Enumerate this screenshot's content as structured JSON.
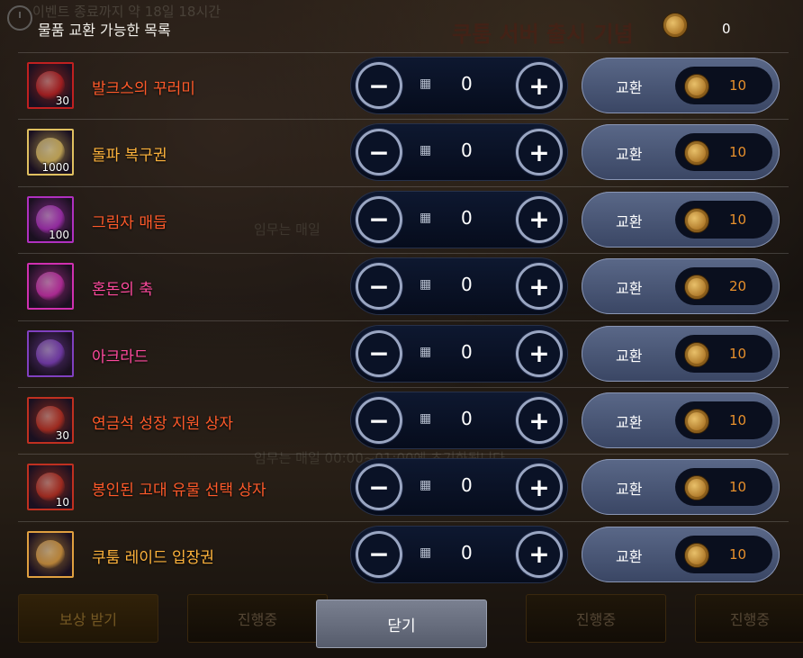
{
  "header": {
    "title": "물품 교환 가능한 목록",
    "currency_amount": "0"
  },
  "background": {
    "event_text": "이벤트 종료까지 약 18일 18시간",
    "promo_text": "쿠툼 서버 출시 기념",
    "warnings": [
      "임무는 매일",
      "임무는 매일 00:00~01:00에 초기화됩니다"
    ],
    "bottom_buttons": [
      "보상 받기",
      "진행중",
      "진행중",
      "진행중"
    ]
  },
  "colors": {
    "orange_name": "#ff6a28",
    "yellow_name": "#ffb43c",
    "pink_name": "#ff4a9e",
    "price": "#e8902c"
  },
  "items": [
    {
      "name": "발크스의 꾸러미",
      "qty": "30",
      "count": "0",
      "price": "10",
      "color": "#ff5a2a",
      "icon": "bag-icon",
      "frame": "#c02020"
    },
    {
      "name": "돌파 복구권",
      "qty": "1000",
      "count": "0",
      "price": "10",
      "color": "#ffb43c",
      "icon": "scroll-icon",
      "frame": "#e0c060"
    },
    {
      "name": "그림자 매듭",
      "qty": "100",
      "count": "0",
      "price": "10",
      "color": "#ff5a2a",
      "icon": "knot-icon",
      "frame": "#b030c0"
    },
    {
      "name": "혼돈의 축",
      "qty": "",
      "count": "0",
      "price": "20",
      "color": "#ff4a9e",
      "icon": "crystal-icon",
      "frame": "#d030b0"
    },
    {
      "name": "아크라드",
      "qty": "",
      "count": "0",
      "price": "10",
      "color": "#ff4a9e",
      "icon": "gem-icon",
      "frame": "#8040c0"
    },
    {
      "name": "연금석 성장 지원 상자",
      "qty": "30",
      "count": "0",
      "price": "10",
      "color": "#ff5a2a",
      "icon": "chest-icon",
      "frame": "#c03020"
    },
    {
      "name": "봉인된 고대 유물 선택 상자",
      "qty": "10",
      "count": "0",
      "price": "10",
      "color": "#ff5a2a",
      "icon": "silver-chest-icon",
      "frame": "#c03020"
    },
    {
      "name": "쿠툼 레이드 입장권",
      "qty": "",
      "count": "0",
      "price": "10",
      "color": "#ffb43c",
      "icon": "ticket-icon",
      "frame": "#e0a040"
    }
  ],
  "labels": {
    "exchange": "교환",
    "minus": "−",
    "plus": "+",
    "close": "닫기"
  }
}
